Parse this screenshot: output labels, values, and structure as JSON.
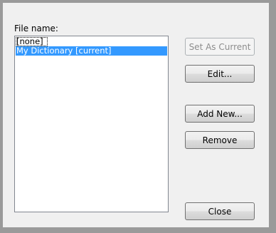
{
  "dialog": {
    "file_name_label": "File name:",
    "list_items": [
      "[none]",
      "My Dictionary [current]"
    ],
    "selected_index": 1,
    "buttons": {
      "set_as_current": "Set As Current",
      "edit": "Edit...",
      "add_new": "Add New...",
      "remove": "Remove",
      "close": "Close"
    }
  },
  "colors": {
    "selection": "#3399ff",
    "dialog_background": "#f0f0f0",
    "frame": "#9a9a9a"
  }
}
